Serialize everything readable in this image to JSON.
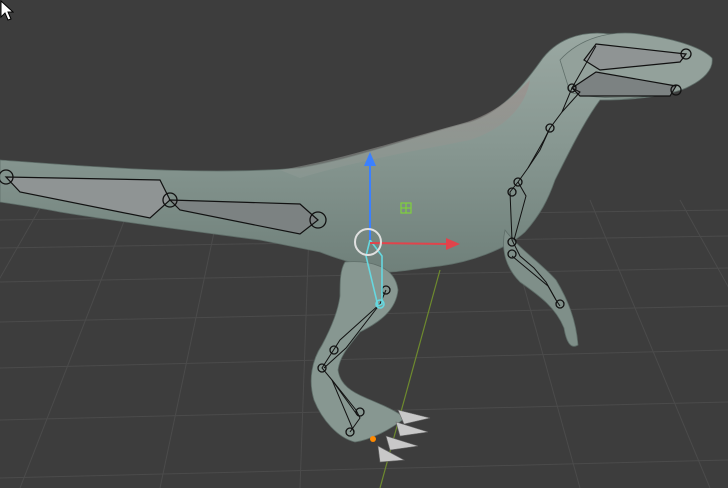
{
  "viewport": {
    "background_color": "#3d3d3d",
    "grid_color": "#4a4a4a",
    "object": "raptor-model",
    "skin_color": "#8a9a92",
    "bone_color": "#8f9494",
    "selected_bone_color": "#66d8e0",
    "gizmo": {
      "x_axis_color": "#e2434b",
      "z_axis_color": "#3b80ff",
      "y_axis_color": "#7fd13b",
      "pivot_color": "#e0e0e0"
    },
    "origin_color": "#ff8a00"
  },
  "icons": {
    "cursor": "mouse-pointer-icon",
    "translate_gizmo": "move-gizmo-icon"
  }
}
